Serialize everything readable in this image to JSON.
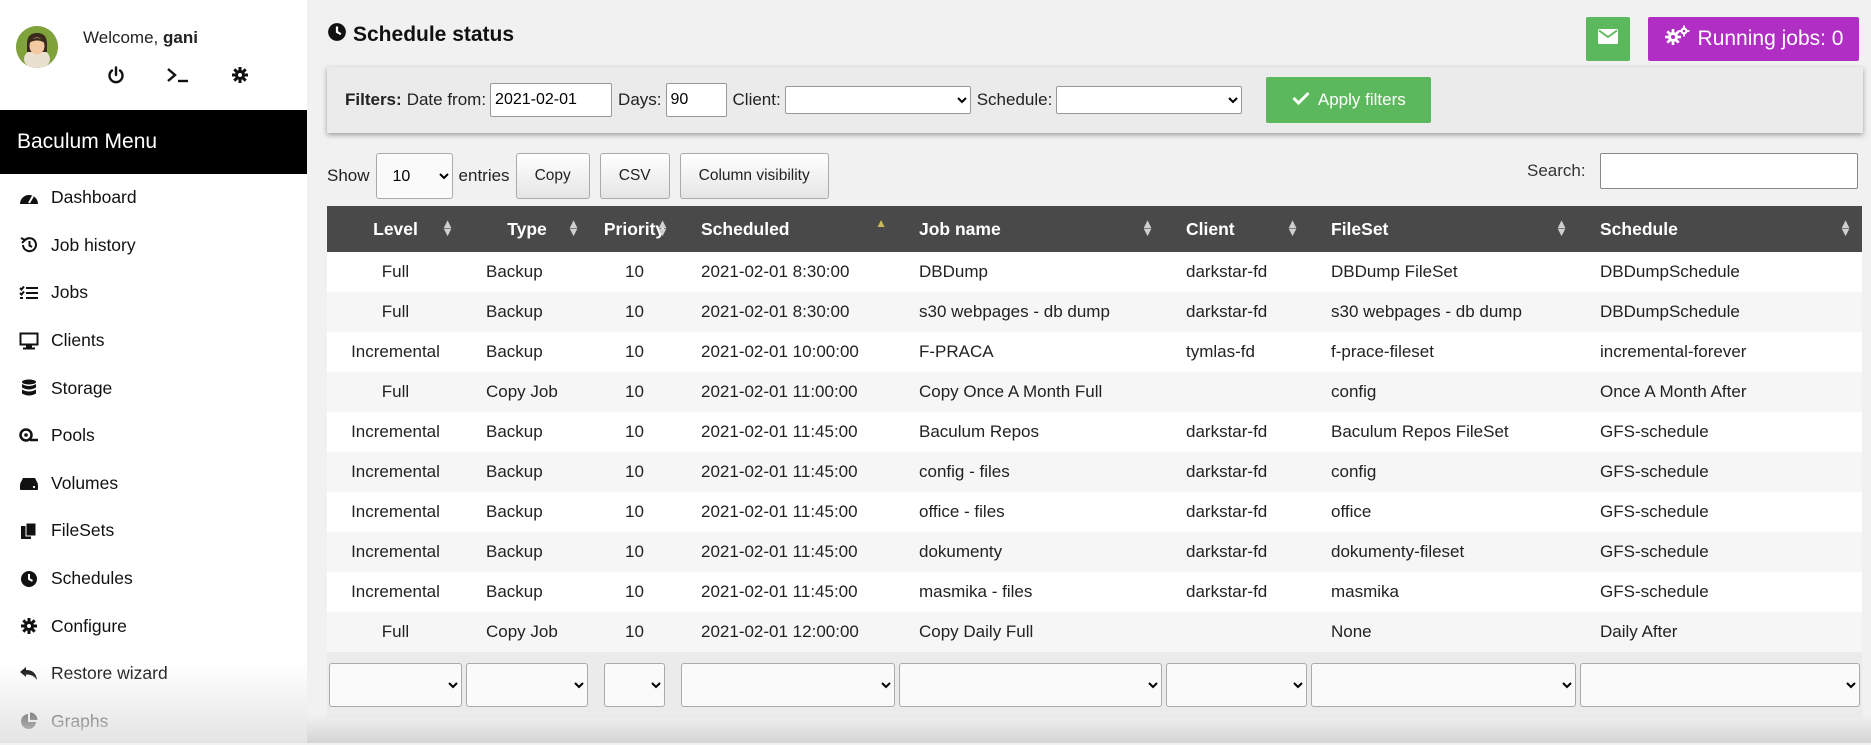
{
  "user": {
    "welcome_prefix": "Welcome, ",
    "name": "gani"
  },
  "sidebar": {
    "title": "Baculum Menu",
    "items": [
      {
        "label": "Dashboard",
        "icon": "dashboard-icon"
      },
      {
        "label": "Job history",
        "icon": "history-icon"
      },
      {
        "label": "Jobs",
        "icon": "list-icon"
      },
      {
        "label": "Clients",
        "icon": "desktop-icon"
      },
      {
        "label": "Storage",
        "icon": "database-icon"
      },
      {
        "label": "Pools",
        "icon": "pools-icon"
      },
      {
        "label": "Volumes",
        "icon": "hdd-icon"
      },
      {
        "label": "FileSets",
        "icon": "files-icon"
      },
      {
        "label": "Schedules",
        "icon": "clock-icon"
      },
      {
        "label": "Configure",
        "icon": "cog-icon"
      },
      {
        "label": "Restore wizard",
        "icon": "undo-icon"
      },
      {
        "label": "Graphs",
        "icon": "chart-pie-icon"
      }
    ]
  },
  "header": {
    "title": "Schedule status",
    "running_jobs_label": "Running jobs: 0"
  },
  "filters": {
    "label": "Filters:",
    "date_from_label": "Date from:",
    "date_from_value": "2021-02-01",
    "days_label": "Days:",
    "days_value": "90",
    "client_label": "Client:",
    "client_value": "",
    "schedule_label": "Schedule:",
    "schedule_value": "",
    "apply_label": "Apply filters"
  },
  "table_controls": {
    "show_label": "Show",
    "page_length": "10",
    "entries_label": "entries",
    "copy_label": "Copy",
    "csv_label": "CSV",
    "colvis_label": "Column visibility",
    "search_label": "Search:",
    "search_value": ""
  },
  "table": {
    "columns": [
      "Level",
      "Type",
      "Priority",
      "Scheduled",
      "Job name",
      "Client",
      "FileSet",
      "Schedule"
    ],
    "sorted_column": "Scheduled",
    "rows": [
      [
        "Full",
        "Backup",
        "10",
        "2021-02-01 8:30:00",
        "DBDump",
        "darkstar-fd",
        "DBDump FileSet",
        "DBDumpSchedule"
      ],
      [
        "Full",
        "Backup",
        "10",
        "2021-02-01 8:30:00",
        "s30 webpages - db dump",
        "darkstar-fd",
        "s30 webpages - db dump",
        "DBDumpSchedule"
      ],
      [
        "Incremental",
        "Backup",
        "10",
        "2021-02-01 10:00:00",
        "F-PRACA",
        "tymlas-fd",
        "f-prace-fileset",
        "incremental-forever"
      ],
      [
        "Full",
        "Copy Job",
        "10",
        "2021-02-01 11:00:00",
        "Copy Once A Month Full",
        "",
        "config",
        "Once A Month After"
      ],
      [
        "Incremental",
        "Backup",
        "10",
        "2021-02-01 11:45:00",
        "Baculum Repos",
        "darkstar-fd",
        "Baculum Repos FileSet",
        "GFS-schedule"
      ],
      [
        "Incremental",
        "Backup",
        "10",
        "2021-02-01 11:45:00",
        "config - files",
        "darkstar-fd",
        "config",
        "GFS-schedule"
      ],
      [
        "Incremental",
        "Backup",
        "10",
        "2021-02-01 11:45:00",
        "office - files",
        "darkstar-fd",
        "office",
        "GFS-schedule"
      ],
      [
        "Incremental",
        "Backup",
        "10",
        "2021-02-01 11:45:00",
        "dokumenty",
        "darkstar-fd",
        "dokumenty-fileset",
        "GFS-schedule"
      ],
      [
        "Incremental",
        "Backup",
        "10",
        "2021-02-01 11:45:00",
        "masmika - files",
        "darkstar-fd",
        "masmika",
        "GFS-schedule"
      ],
      [
        "Full",
        "Copy Job",
        "10",
        "2021-02-01 12:00:00",
        "Copy Daily Full",
        "",
        "None",
        "Daily After"
      ]
    ]
  },
  "colors": {
    "accent_green": "#5cb85c",
    "running_jobs_purple": "#b12ec5",
    "header_dark": "#494949"
  }
}
